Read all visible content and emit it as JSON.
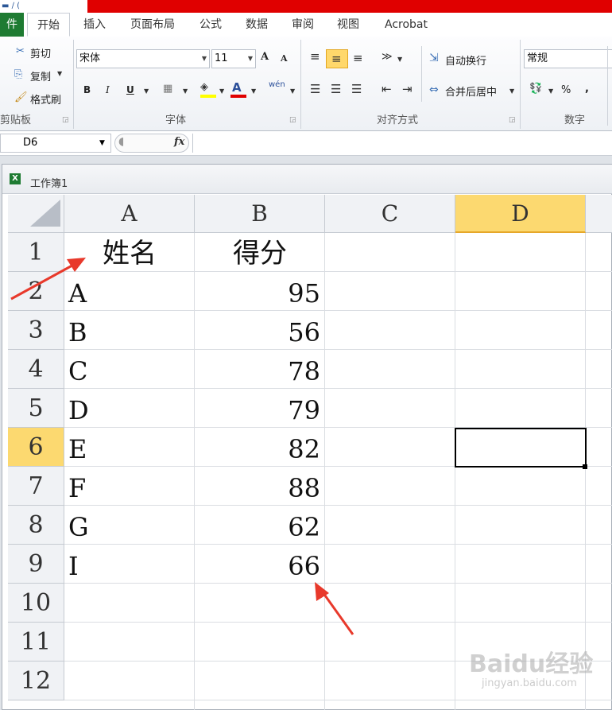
{
  "ribbon": {
    "tabs": {
      "file": "件",
      "home": "开始",
      "insert": "插入",
      "layout": "页面布局",
      "formula": "公式",
      "data": "数据",
      "review": "审阅",
      "view": "视图",
      "acrobat": "Acrobat"
    },
    "clipboard": {
      "cut": "剪切",
      "copy": "复制",
      "format_painter": "格式刷",
      "label": "剪贴板"
    },
    "font": {
      "name": "宋体",
      "size": "11",
      "bold": "B",
      "italic": "I",
      "underline": "U",
      "grow": "A",
      "shrink": "A",
      "font_color_glyph": "A",
      "phonetic": "wén",
      "label": "字体"
    },
    "alignment": {
      "wrap_text": "自动换行",
      "merge_center": "合并后居中",
      "label": "对齐方式"
    },
    "number": {
      "format": "常规",
      "percent": "%",
      "comma": ",",
      "label": "数字"
    }
  },
  "formula_bar": {
    "name_box": "D6",
    "fx": "fx",
    "formula": ""
  },
  "workbook": {
    "title": "工作簿1"
  },
  "sheet": {
    "columns": [
      "A",
      "B",
      "C",
      "D"
    ],
    "rows": [
      "1",
      "2",
      "3",
      "4",
      "5",
      "6",
      "7",
      "8",
      "9",
      "10",
      "11",
      "12"
    ],
    "header": {
      "name": "姓名",
      "score": "得分"
    },
    "data": [
      {
        "name": "A",
        "score": "95"
      },
      {
        "name": "B",
        "score": "56"
      },
      {
        "name": "C",
        "score": "78"
      },
      {
        "name": "D",
        "score": "79"
      },
      {
        "name": "E",
        "score": "82"
      },
      {
        "name": "F",
        "score": "88"
      },
      {
        "name": "G",
        "score": "62"
      },
      {
        "name": "I",
        "score": "66"
      }
    ],
    "selected_cell": "D6"
  },
  "watermark": {
    "main": "Baidu经验",
    "sub": "jingyan.baidu.com"
  },
  "colors": {
    "accent_red": "#e00000",
    "file_tab": "#1e7b32",
    "selected_header": "#fcd970",
    "annotation_arrow": "#e8392b"
  }
}
